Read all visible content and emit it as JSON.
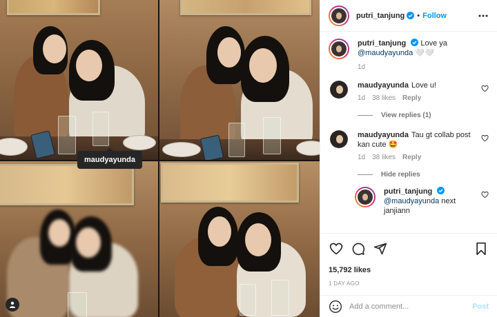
{
  "post": {
    "author": "putri_tanjung",
    "follow_label": "Follow",
    "dot": "•",
    "tag_tooltip": "maudyayunda",
    "caption": {
      "username": "putri_tanjung",
      "text": "Love ya",
      "mention": "@maudyayunda",
      "emoji": "🤍🤍",
      "time": "1d"
    },
    "likes": "15,792 likes",
    "date": "1 DAY AGO"
  },
  "comments": [
    {
      "username": "maudyayunda",
      "text": "Love u!",
      "time": "1d",
      "likes": "38 likes",
      "reply_label": "Reply",
      "replies_toggle": "View replies (1)"
    },
    {
      "username": "maudyayunda",
      "text": "Tau gt collab post kan cute 🤩",
      "time": "1d",
      "likes": "38 likes",
      "reply_label": "Reply",
      "replies_toggle": "Hide replies"
    }
  ],
  "reply": {
    "username": "putri_tanjung",
    "mention": "@maudyayunda",
    "text": "next janjiann"
  },
  "composer": {
    "placeholder": "Add a comment...",
    "post_label": "Post"
  },
  "colors": {
    "accent": "#0095f6",
    "post_disabled": "#b2dffc",
    "verified": "#0095f6",
    "text": "#262626",
    "muted": "#8e8e8e"
  },
  "icons": {
    "verified": "verified-badge-icon",
    "more": "more-options-icon",
    "like": "heart-icon",
    "comment": "comment-icon",
    "share": "share-icon",
    "save": "bookmark-icon",
    "emoji": "emoji-icon",
    "tag": "user-tag-icon"
  }
}
